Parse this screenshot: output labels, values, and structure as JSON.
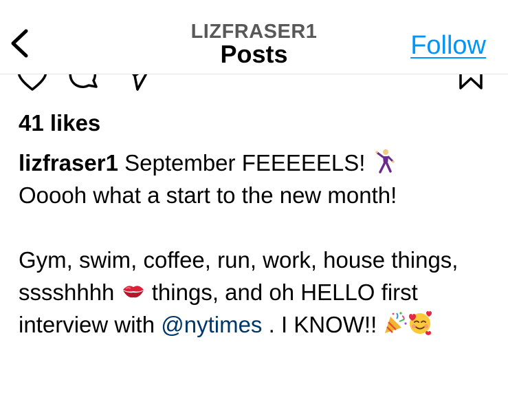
{
  "header": {
    "username": "LIZFRASER1",
    "title": "Posts",
    "follow_label": "Follow"
  },
  "icons": {
    "back": "chevron-left-icon",
    "like": "heart-icon",
    "comment": "comment-icon",
    "share": "send-icon",
    "save": "bookmark-icon"
  },
  "post": {
    "likes": "41 likes",
    "author": "lizfraser1",
    "caption_line1": " September FEEEEELS! ",
    "emoji_1": "dancing-man-emoji",
    "caption_line2": "Ooooh what a start to the new month!",
    "caption_p2_a": "Gym, swim, coffee, run, work, house things, sssshhhh ",
    "emoji_2": "kiss-lips-emoji",
    "caption_p2_b": " things, and oh HELLO first interview with ",
    "mention": "@nytimes",
    "caption_p2_c": " . I KNOW!! ",
    "emoji_3": "party-popper-emoji",
    "emoji_4": "smiling-face-with-hearts-emoji"
  },
  "colors": {
    "follow_blue": "#0095f6",
    "mention_blue": "#00376b",
    "username_gray": "#585858"
  }
}
